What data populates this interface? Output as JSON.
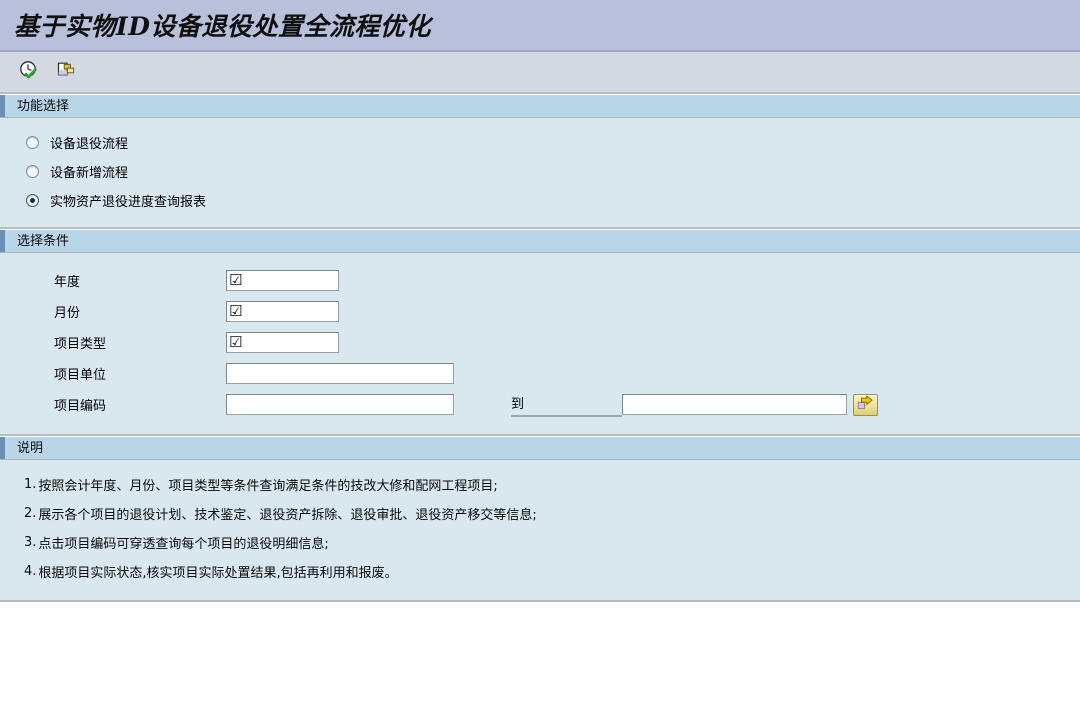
{
  "window": {
    "title": "基于实物ID设备退役处置全流程优化"
  },
  "toolbar": {
    "buttons": [
      {
        "name": "execute-icon",
        "title": "执行 (F8)"
      },
      {
        "name": "multiple-selection-icon",
        "title": "多重选择"
      }
    ]
  },
  "function_section": {
    "header": "功能选择",
    "options": [
      {
        "label": "设备退役流程",
        "selected": false
      },
      {
        "label": "设备新增流程",
        "selected": false
      },
      {
        "label": "实物资产退役进度查询报表",
        "selected": true
      }
    ]
  },
  "condition_section": {
    "header": "选择条件",
    "fields": [
      {
        "label": "年度",
        "value": "",
        "checkbox_glyph": "☑"
      },
      {
        "label": "月份",
        "value": "",
        "checkbox_glyph": "☑"
      },
      {
        "label": "项目类型",
        "value": "",
        "checkbox_glyph": "☑"
      },
      {
        "label": "项目单位",
        "value": ""
      },
      {
        "label": "项目编码",
        "value": ""
      }
    ],
    "to_label": "到",
    "to_value": "",
    "multi_select_button": "⇨"
  },
  "description_section": {
    "header": "说明",
    "lines": [
      {
        "num": "1.",
        "text": "按照会计年度、月份、项目类型等条件查询满足条件的技改大修和配网工程项目;"
      },
      {
        "num": "2.",
        "text": "展示各个项目的退役计划、技术鉴定、退役资产拆除、退役审批、退役资产移交等信息;"
      },
      {
        "num": "3.",
        "text": "点击项目编码可穿透查询每个项目的退役明细信息;"
      },
      {
        "num": "4.",
        "text": "根据项目实际状态,核实项目实际处置结果,包括再利用和报废。"
      }
    ]
  },
  "colors": {
    "title_bar": "#b9c0dc",
    "toolbar": "#d3d8e3",
    "section_header": "#b8d6e8",
    "panel": "#d9e8ef",
    "accent": "#6e8fb4"
  }
}
